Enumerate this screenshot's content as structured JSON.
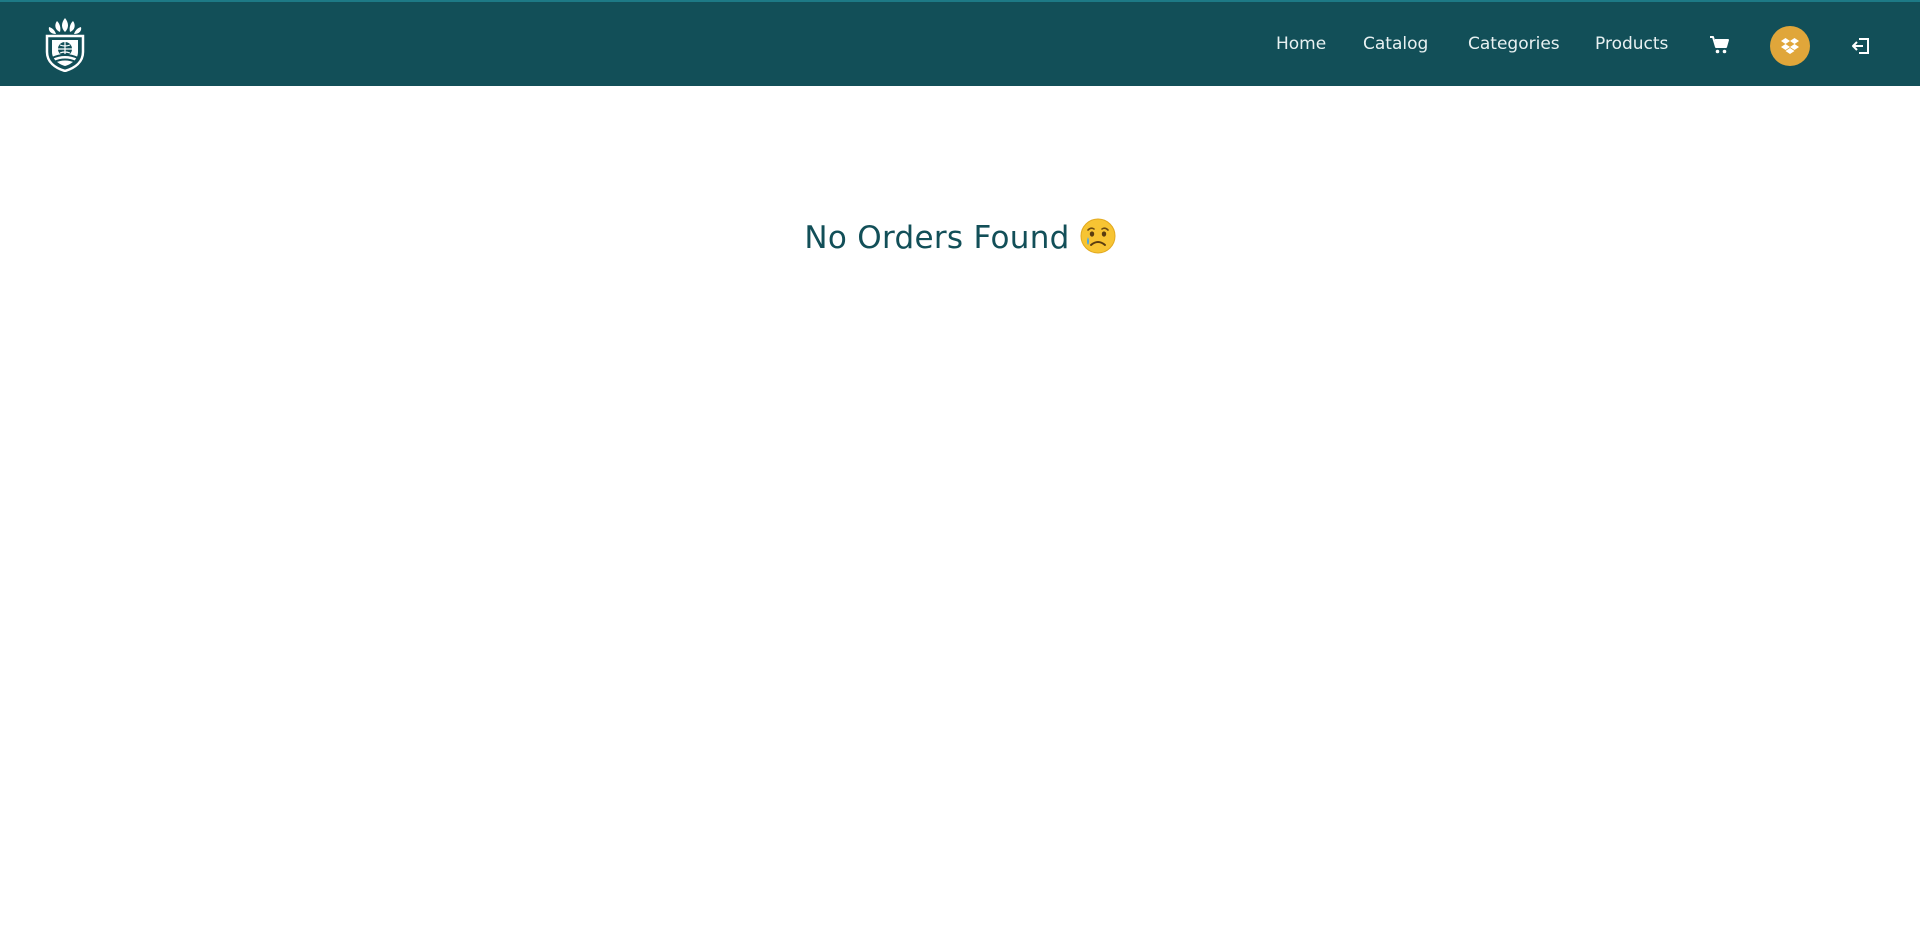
{
  "nav": {
    "links": [
      {
        "label": "Home"
      },
      {
        "label": "Catalog"
      },
      {
        "label": "Categories"
      },
      {
        "label": "Products"
      }
    ],
    "icons": {
      "logo": "brand-logo-icon",
      "cart": "cart-icon",
      "avatar": "dropbox-icon",
      "logout": "logout-icon"
    }
  },
  "main": {
    "message": "No Orders Found",
    "emoji": "crying-face-icon"
  },
  "colors": {
    "navbar": "#124f58",
    "accent": "#e0a63a",
    "text": "#124f58"
  }
}
